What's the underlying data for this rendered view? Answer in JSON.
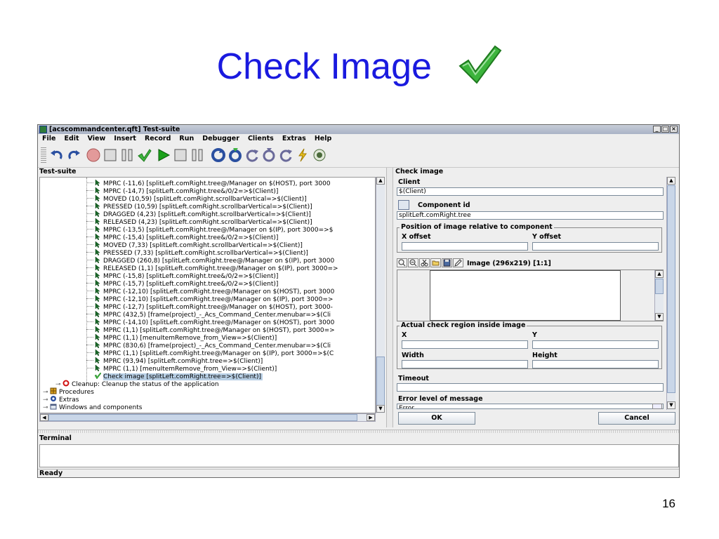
{
  "slide": {
    "title": "Check Image",
    "page_number": "16"
  },
  "window": {
    "title": "[acscommandcenter.qft] Test-suite",
    "buttons": [
      "_",
      "□",
      "×"
    ]
  },
  "menu": [
    "File",
    "Edit",
    "View",
    "Insert",
    "Record",
    "Run",
    "Debugger",
    "Clients",
    "Extras",
    "Help"
  ],
  "left_panel": {
    "header": "Test-suite",
    "rows": [
      "MPRC (-11,6) [splitLeft.comRight.tree@/Manager on $(HOST), port 3000",
      "MPRC (-14,7) [splitLeft.comRight.tree&/0/2=>$(Client)]",
      "MOVED (10,59) [splitLeft.comRight.scrollbarVertical=>$(Client)]",
      "PRESSED (10,59) [splitLeft.comRight.scrollbarVertical=>$(Client)]",
      "DRAGGED (4,23) [splitLeft.comRight.scrollbarVertical=>$(Client)]",
      "RELEASED (4,23) [splitLeft.comRight.scrollbarVertical=>$(Client)]",
      "MPRC (-13,5) [splitLeft.comRight.tree@/Manager on $(IP), port 3000=>$",
      "MPRC (-15,4) [splitLeft.comRight.tree&/0/2=>$(Client)]",
      "MOVED (7,33) [splitLeft.comRight.scrollbarVertical=>$(Client)]",
      "PRESSED (7,33) [splitLeft.comRight.scrollbarVertical=>$(Client)]",
      "DRAGGED (260,8) [splitLeft.comRight.tree@/Manager on $(IP), port 3000",
      "RELEASED (1,1) [splitLeft.comRight.tree@/Manager on $(IP), port 3000=>",
      "MPRC (-15,8) [splitLeft.comRight.tree&/0/2=>$(Client)]",
      "MPRC (-15,7) [splitLeft.comRight.tree&/0/2=>$(Client)]",
      "MPRC (-12,10) [splitLeft.comRight.tree@/Manager on $(HOST), port 3000",
      "MPRC (-12,10) [splitLeft.comRight.tree@/Manager on $(IP), port 3000=>",
      "MPRC (-12,7) [splitLeft.comRight.tree@/Manager on $(HOST), port 3000-",
      "MPRC (432,5) [frame(project)_-_Acs_Command_Center.menubar=>$(Cli",
      "MPRC (-14,10) [splitLeft.comRight.tree@/Manager on $(HOST), port 3000",
      "MPRC (1,1) [splitLeft.comRight.tree@/Manager on $(HOST), port 3000=>",
      "MPRC (1,1) [menuItemRemove_from_View=>$(Client)]",
      "MPRC (830,6) [frame(project)_-_Acs_Command_Center.menubar=>$(Cli",
      "MPRC (1,1) [splitLeft.comRight.tree@/Manager on $(IP), port 3000=>$(C",
      "MPRC (93,94) [splitLeft.comRight.tree=>$(Client)]",
      "MPRC (1,1) [menuItemRemove_from_View=>$(Client)]"
    ],
    "selected_row": "Check image [splitLeft.comRight.tree=>$(Client)]",
    "cleanup": "Cleanup: Cleanup the status of the application",
    "procedures": "Procedures",
    "extras": "Extras",
    "windows": "Windows and components"
  },
  "right_panel": {
    "header": "Check image",
    "client_label": "Client",
    "client_value": "$(Client)",
    "component_label": "Component id",
    "component_value": "splitLeft.comRight.tree",
    "position_group": "Position of image relative to component",
    "x_offset_label": "X offset",
    "y_offset_label": "Y offset",
    "image_label": "Image (296x219) [1:1]",
    "region_group": "Actual check region inside image",
    "x_label": "X",
    "y_label": "Y",
    "width_label": "Width",
    "height_label": "Height",
    "timeout_label": "Timeout",
    "error_level_label": "Error level of message",
    "error_level_value": "Error",
    "ok_label": "OK",
    "cancel_label": "Cancel"
  },
  "terminal": {
    "header": "Terminal",
    "status": "Ready"
  },
  "colors": {
    "title_blue": "#1a1adf",
    "selection": "#b8cfe5",
    "check_green": "#3cb43c"
  },
  "icons": {
    "title_check": "green-checkmark-icon",
    "tree_step": "mouse-event-icon",
    "tree_check": "check-image-icon"
  }
}
